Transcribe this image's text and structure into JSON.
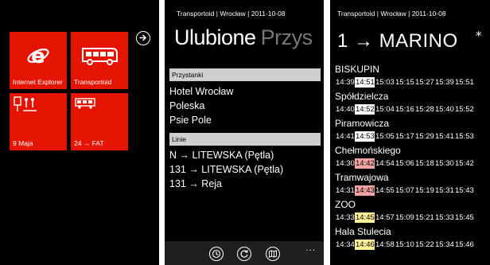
{
  "panel1": {
    "tiles": [
      {
        "label": "Internet Explorer",
        "icon": "internet-explorer-icon"
      },
      {
        "label": "Transportoid",
        "icon": "bus-icon"
      },
      {
        "label": "9 Maja",
        "icon": "bus-stop-icon"
      },
      {
        "label": "24 → FAT",
        "icon": "tram-icon"
      }
    ],
    "tile_color": "#e51400"
  },
  "panel2": {
    "app_title": "Transportoid | Wrocław | 2011-10-08",
    "pivot_active": "Ulubione",
    "pivot_next": "Przys",
    "stops_header": "Przystanki",
    "stops": [
      "Hotel Wrocław",
      "Poleska",
      "Psie Pole"
    ],
    "lines_header": "Linie",
    "lines": [
      "N → LITEWSKA (Pętla)",
      "131 → LITEWSKA (Pętla)",
      "131 → Reja"
    ],
    "appbar_buttons": [
      "clock-icon",
      "refresh-icon",
      "map-icon"
    ],
    "appbar_more": "..."
  },
  "panel3": {
    "app_title": "Transportoid | Wrocław | 2011-10-08",
    "route_title": "1 → MARINO",
    "star": "*",
    "stops": [
      {
        "name": "BISKUPIN",
        "times": [
          "14:39",
          "14:51",
          "15:03",
          "15:15",
          "15:27",
          "15:39",
          "15:51"
        ],
        "highlight": 1,
        "hl_color": "white"
      },
      {
        "name": "Spółdzielcza",
        "times": [
          "14:40",
          "14:52",
          "15:04",
          "15:16",
          "15:28",
          "15:40",
          "15:52"
        ],
        "highlight": 1,
        "hl_color": "white"
      },
      {
        "name": "Piramowicza",
        "times": [
          "14:41",
          "14:53",
          "15:05",
          "15:17",
          "15:29",
          "15:41",
          "15:53"
        ],
        "highlight": 1,
        "hl_color": "white"
      },
      {
        "name": "Chełmońskiego",
        "times": [
          "14:30",
          "14:42",
          "14:54",
          "15:06",
          "15:18",
          "15:30",
          "15:42"
        ],
        "highlight": 1,
        "hl_color": "red"
      },
      {
        "name": "Tramwajowa",
        "times": [
          "14:31",
          "14:43",
          "14:55",
          "15:07",
          "15:19",
          "15:31",
          "15:43"
        ],
        "highlight": 1,
        "hl_color": "red"
      },
      {
        "name": "ZOO",
        "times": [
          "14:33",
          "14:45",
          "14:57",
          "15:09",
          "15:21",
          "15:33",
          "15:45"
        ],
        "highlight": 1,
        "hl_color": "yellow"
      },
      {
        "name": "Hala Stulecia",
        "times": [
          "14:34",
          "14:46",
          "14:58",
          "15:10",
          "15:22",
          "15:34",
          "15:46"
        ],
        "highlight": 1,
        "hl_color": "yellow"
      }
    ]
  }
}
